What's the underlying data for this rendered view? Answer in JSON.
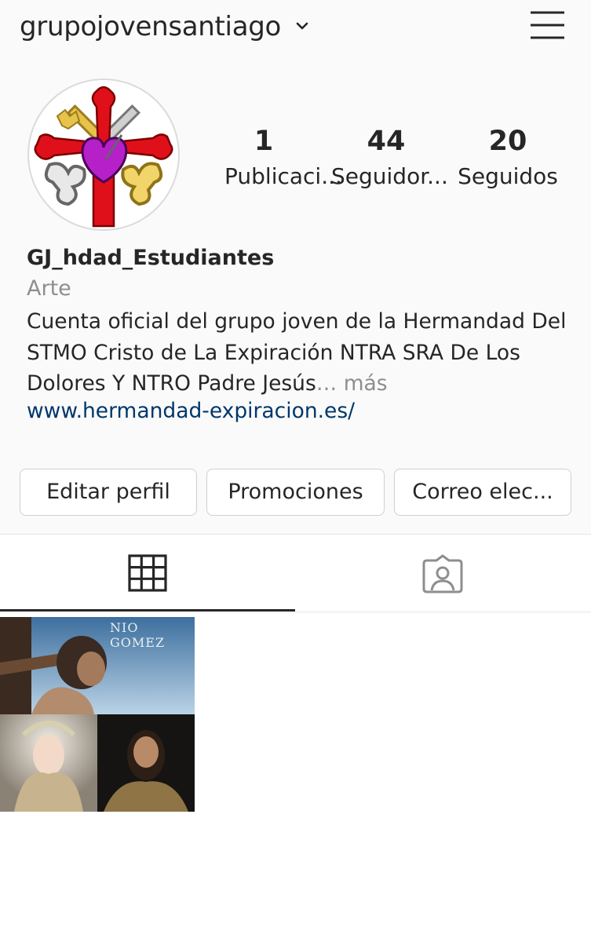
{
  "header": {
    "username": "grupojovensantiago"
  },
  "stats": [
    {
      "count": "1",
      "label": "Publicaci..."
    },
    {
      "count": "44",
      "label": "Seguidor..."
    },
    {
      "count": "20",
      "label": "Seguidos"
    }
  ],
  "profile": {
    "name": "GJ_hdad_Estudiantes",
    "category": "Arte",
    "bio_text": "Cuenta oficial del grupo joven de la Hermandad Del STMO Cristo de La Expiración NTRA SRA De Los Dolores Y NTRO Padre Jesús",
    "bio_ellipsis": "… ",
    "bio_more": "más",
    "website": "www.hermandad-expiracion.es/"
  },
  "buttons": {
    "edit": "Editar perfil",
    "promotions": "Promociones",
    "email": "Correo elec..."
  },
  "posts": {
    "thumb_watermark": "NIO GOMEZ"
  },
  "colors": {
    "link": "#00376b",
    "muted": "#8e8e8e",
    "text": "#262626"
  }
}
